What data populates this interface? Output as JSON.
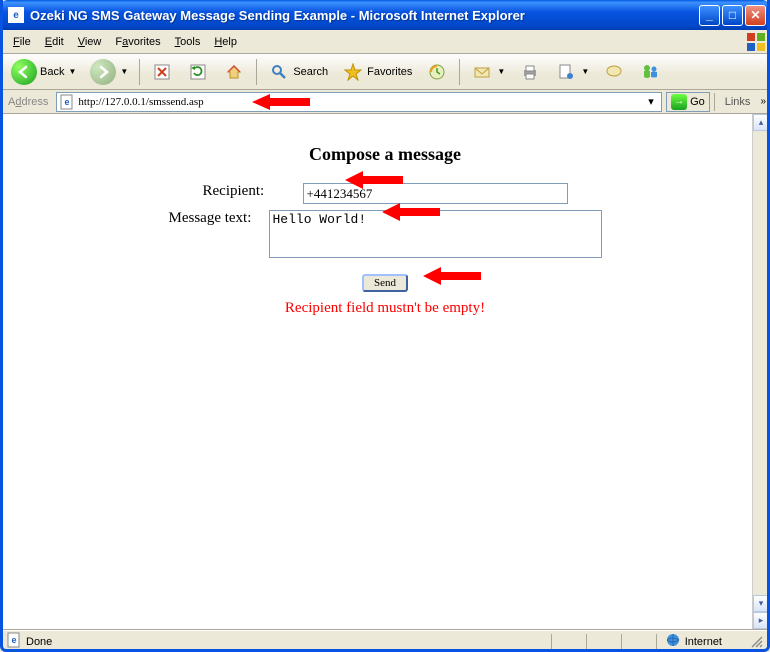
{
  "window": {
    "title": "Ozeki NG SMS Gateway Message Sending Example - Microsoft Internet Explorer"
  },
  "menu": {
    "file": "File",
    "edit": "Edit",
    "view": "View",
    "favorites": "Favorites",
    "tools": "Tools",
    "help": "Help"
  },
  "toolbar": {
    "back": "Back",
    "search": "Search",
    "favorites": "Favorites"
  },
  "address": {
    "label": "Address",
    "url": "http://127.0.0.1/smssend.asp",
    "go": "Go",
    "links": "Links"
  },
  "page": {
    "heading": "Compose a message",
    "recipient_label": "Recipient:",
    "recipient_value": "+441234567",
    "message_label": "Message text:",
    "message_value": "Hello World!",
    "send_label": "Send",
    "error": "Recipient field mustn't be empty!"
  },
  "status": {
    "text": "Done",
    "zone": "Internet"
  }
}
